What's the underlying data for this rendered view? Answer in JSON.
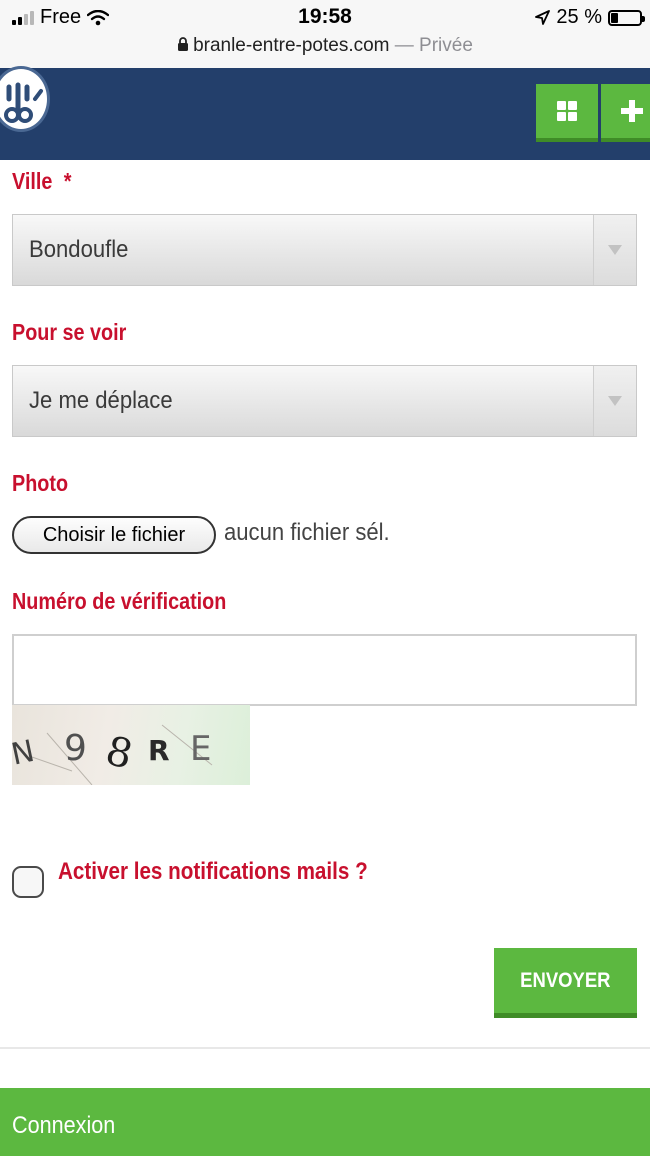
{
  "status_bar": {
    "carrier": "Free",
    "time": "19:58",
    "battery_text": "25 %",
    "battery_level": 0.25,
    "url": "branle-entre-potes.com",
    "url_suffix": "— Privée"
  },
  "header": {
    "icons": [
      "grid-icon",
      "plus-icon"
    ],
    "colors": {
      "background": "#233f6b",
      "button": "#5cb840"
    }
  },
  "form": {
    "ville": {
      "label": "Ville",
      "required_mark": "*",
      "value": "Bondoufle"
    },
    "pour_se_voir": {
      "label": "Pour se voir",
      "value": "Je me déplace"
    },
    "photo": {
      "label": "Photo",
      "button_label": "Choisir le fichier",
      "status": "aucun fichier sél."
    },
    "verification": {
      "label": "Numéro de vérification",
      "value": "",
      "captcha_text": "N9 8RE"
    },
    "notifications": {
      "label": "Activer les notifications mails ?",
      "checked": false
    },
    "submit_label": "ENVOYER"
  },
  "footer": {
    "login_label": "Connexion"
  },
  "colors": {
    "accent_red": "#c8102e",
    "green": "#5cb840",
    "navy": "#233f6b"
  }
}
